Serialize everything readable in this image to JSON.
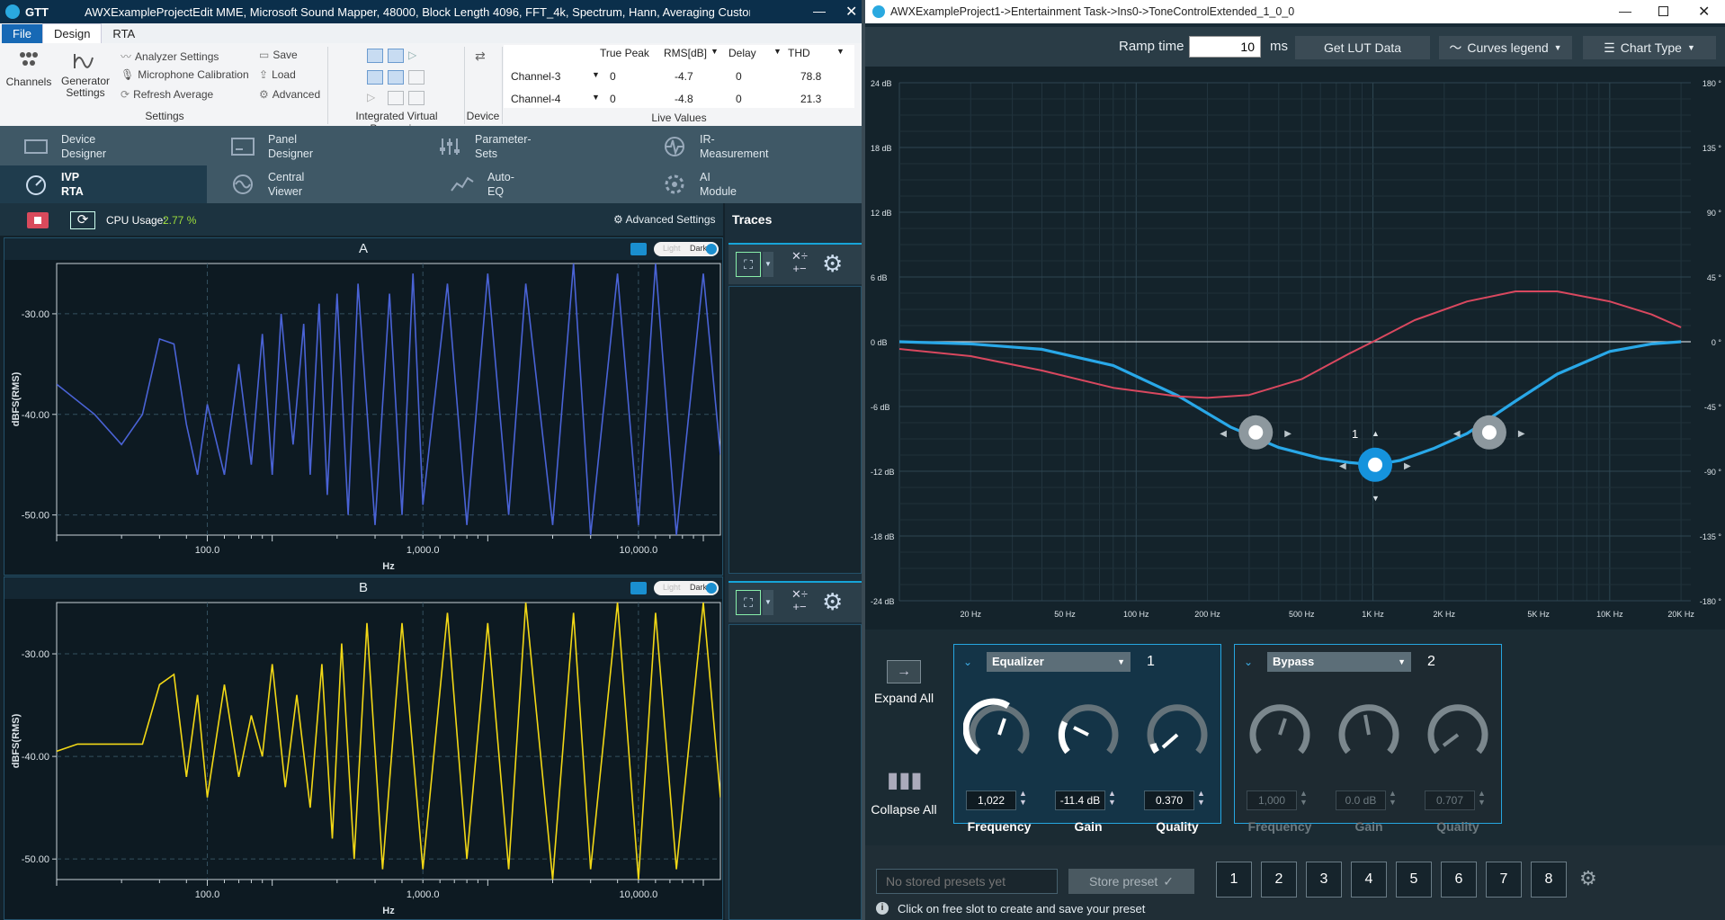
{
  "left_window": {
    "title_app": "GTT",
    "title": "AWXExampleProjectEdit MME, Microsoft Sound Mapper, 48000, Block Length 4096, FFT_4k, Spectrum, Hann, Averaging Custom, Ban...",
    "tabs": [
      "File",
      "Design",
      "RTA"
    ],
    "ribbon": {
      "channels": "Channels",
      "generator_settings": "Generator Settings",
      "analyzer_settings": "Analyzer Settings",
      "microphone_calibration": "Microphone Calibration",
      "refresh_average": "Refresh Average",
      "save": "Save",
      "load": "Load",
      "advanced": "Advanced",
      "group_settings": "Settings",
      "group_ivp": "Integrated Virtual Processing",
      "group_device": "Device",
      "group_live": "Live Values",
      "live_headers": [
        "True Peak",
        "RMS[dB]",
        "Delay",
        "THD"
      ],
      "live_rows": [
        {
          "name": "Channel-3",
          "true_peak": "0",
          "rms": "-4.7",
          "delay": "0",
          "thd": "78.8"
        },
        {
          "name": "Channel-4",
          "true_peak": "0",
          "rms": "-4.8",
          "delay": "0",
          "thd": "21.3"
        }
      ]
    },
    "nav": {
      "device_designer": "Device Designer",
      "panel_designer": "Panel Designer",
      "parameter_sets": "Parameter-Sets",
      "ir_measurement": "IR-Measurement",
      "ivp_rta": "IVP RTA",
      "central_viewer": "Central Viewer",
      "auto_eq": "Auto-EQ",
      "ai_module": "AI Module"
    },
    "toolbar": {
      "cpu_label": "CPU Usage:",
      "cpu_value": "2.77 %",
      "advanced_settings": "Advanced Settings",
      "traces": "Traces"
    },
    "charts": [
      {
        "title": "A",
        "toggle_light": "Light",
        "toggle_dark": "Dark"
      },
      {
        "title": "B",
        "toggle_light": "Light",
        "toggle_dark": "Dark"
      }
    ]
  },
  "chart_data": [
    {
      "type": "line",
      "title": "A",
      "xlabel": "Hz",
      "ylabel": "dBFS(RMS)",
      "x_scale": "log",
      "xlim": [
        20,
        24000
      ],
      "ylim": [
        -52,
        -25
      ],
      "x_ticks": [
        "100.0",
        "1,000.0",
        "10,000.0"
      ],
      "y_ticks": [
        "-30.00",
        "-40.00",
        "-50.00"
      ],
      "series": [
        {
          "color": "#4a63d6",
          "x": [
            20,
            30,
            40,
            50,
            60,
            70,
            80,
            90,
            100,
            120,
            140,
            160,
            180,
            200,
            220,
            250,
            280,
            300,
            330,
            360,
            400,
            450,
            500,
            600,
            700,
            800,
            900,
            1000,
            1300,
            1600,
            2000,
            2500,
            3000,
            4000,
            5000,
            6000,
            8000,
            10000,
            12000,
            15000,
            20000,
            24000
          ],
          "y": [
            -37,
            -40,
            -43,
            -40,
            -32.5,
            -33,
            -41,
            -46,
            -39,
            -46,
            -35,
            -45,
            -32,
            -46,
            -30,
            -43,
            -31,
            -46,
            -29,
            -48,
            -28,
            -50,
            -27,
            -51,
            -28,
            -50,
            -26,
            -49,
            -27,
            -51,
            -26,
            -50,
            -27,
            -51,
            -25,
            -52,
            -26,
            -51,
            -25,
            -52,
            -26,
            -44
          ]
        }
      ]
    },
    {
      "type": "line",
      "title": "B",
      "xlabel": "Hz",
      "ylabel": "dBFS(RMS)",
      "x_scale": "log",
      "xlim": [
        20,
        24000
      ],
      "ylim": [
        -52,
        -25
      ],
      "x_ticks": [
        "100.0",
        "1,000.0",
        "10,000.0"
      ],
      "y_ticks": [
        "-30.00",
        "-40.00",
        "-50.00"
      ],
      "series": [
        {
          "color": "#f2d816",
          "x": [
            20,
            25,
            30,
            40,
            50,
            60,
            70,
            80,
            90,
            100,
            120,
            140,
            160,
            180,
            200,
            230,
            260,
            300,
            340,
            380,
            420,
            480,
            550,
            650,
            800,
            1000,
            1300,
            1600,
            2000,
            2500,
            3000,
            4000,
            5000,
            6000,
            8000,
            10000,
            12000,
            15000,
            20000,
            24000
          ],
          "y": [
            -39.5,
            -38.8,
            -38.8,
            -38.8,
            -38.8,
            -33,
            -32,
            -42,
            -34,
            -44,
            -33,
            -42,
            -36,
            -40,
            -31,
            -43,
            -34,
            -45,
            -31,
            -48,
            -29,
            -50,
            -27,
            -51,
            -27,
            -51,
            -26,
            -50,
            -27,
            -51,
            -25,
            -52,
            -26,
            -51,
            -25,
            -52,
            -26,
            -51,
            -25,
            -44
          ]
        }
      ]
    },
    {
      "type": "line",
      "title": "",
      "x_scale": "log",
      "xlim": [
        10,
        22000
      ],
      "ylim": [
        -24,
        24
      ],
      "y2lim": [
        -180,
        180
      ],
      "x_ticks": [
        "20 Hz",
        "50 Hz",
        "100 Hz",
        "200 Hz",
        "500 Hz",
        "1K Hz",
        "2K Hz",
        "5K Hz",
        "10K Hz",
        "20K Hz"
      ],
      "y_ticks": [
        "24 dB",
        "18 dB",
        "12 dB",
        "6 dB",
        "0 dB",
        "-6 dB",
        "-12 dB",
        "-18 dB",
        "-24 dB"
      ],
      "y2_ticks": [
        "180 °",
        "135 °",
        "90 °",
        "45 °",
        "0 °",
        "-45 °",
        "-90 °",
        "-135 °",
        "-180 °"
      ],
      "series": [
        {
          "color": "#29a8e8",
          "axis": "left",
          "x": [
            10,
            20,
            40,
            80,
            150,
            250,
            400,
            600,
            800,
            1022,
            1300,
            1800,
            2500,
            4000,
            6000,
            10000,
            15000,
            20000
          ],
          "y": [
            0,
            -0.2,
            -0.7,
            -2.2,
            -5,
            -7.9,
            -9.8,
            -10.8,
            -11.2,
            -11.4,
            -11,
            -9.9,
            -8.5,
            -5.5,
            -3,
            -0.9,
            -0.2,
            0
          ]
        },
        {
          "color": "#d9485f",
          "axis": "right",
          "x": [
            10,
            20,
            40,
            80,
            150,
            200,
            300,
            500,
            800,
            1000,
            1500,
            2500,
            4000,
            6000,
            10000,
            15000,
            20000
          ],
          "y": [
            -5,
            -10,
            -20,
            -32,
            -38,
            -39,
            -37,
            -26,
            -8,
            0,
            15,
            28,
            35,
            35,
            28,
            19,
            10
          ]
        }
      ],
      "handles": [
        {
          "x": 320,
          "y": -8.4
        },
        {
          "x": 1022,
          "y": -11.4,
          "label": "1"
        },
        {
          "x": 3100,
          "y": -8.4
        }
      ]
    }
  ],
  "right_window": {
    "title": "AWXExampleProject1->Entertainment Task->Ins0->ToneControlExtended_1_0_0",
    "ramp_label": "Ramp time",
    "ramp_value": "10",
    "ramp_unit": "ms",
    "get_lut": "Get LUT Data",
    "curves_legend": "Curves legend",
    "chart_type": "Chart Type",
    "expand_all": "Expand All",
    "collapse_all": "Collapse All",
    "band1": {
      "type": "Equalizer",
      "index": "1",
      "freq_value": "1,022",
      "gain_value": "-11.4 dB",
      "q_value": "0.370",
      "freq_label": "Frequency",
      "gain_label": "Gain",
      "q_label": "Quality"
    },
    "band2": {
      "type": "Bypass",
      "index": "2",
      "freq_value": "1,000",
      "gain_value": "0.0 dB",
      "q_value": "0.707",
      "freq_label": "Frequency",
      "gain_label": "Gain",
      "q_label": "Quality"
    },
    "presets": {
      "placeholder": "No stored presets yet",
      "store": "Store preset",
      "slots": [
        "1",
        "2",
        "3",
        "4",
        "5",
        "6",
        "7",
        "8"
      ],
      "hint": "Click on free slot to create and save your preset"
    }
  }
}
